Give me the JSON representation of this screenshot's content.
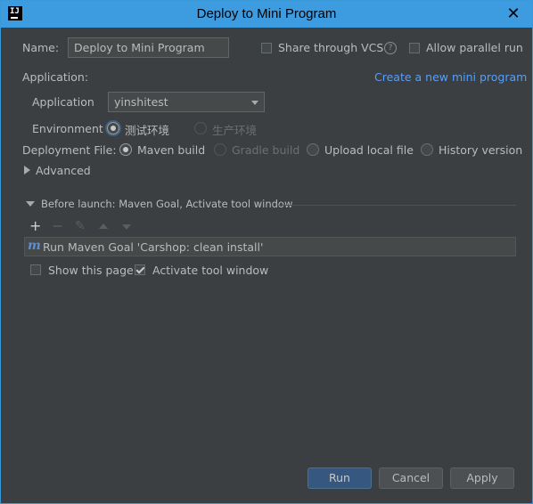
{
  "window": {
    "title": "Deploy to Mini Program",
    "app_icon_text": "IJ",
    "close_glyph": "✕"
  },
  "name": {
    "label": "Name:",
    "value": "Deploy to Mini Program"
  },
  "share_vcs": {
    "label": "Share through VCS",
    "checked": false,
    "help_glyph": "?"
  },
  "allow_parallel": {
    "label": "Allow parallel run",
    "checked": false
  },
  "application_section": {
    "heading": "Application:",
    "create_link": "Create a new mini program",
    "application_label": "Application",
    "application_value": "yinshitest",
    "environment_label": "Environment",
    "environment_options": [
      {
        "label": "测试环境",
        "selected": true
      },
      {
        "label": "生产环境",
        "selected": false,
        "disabled": true
      }
    ]
  },
  "deployment": {
    "label": "Deployment File:",
    "options": [
      {
        "label": "Maven build",
        "selected": true
      },
      {
        "label": "Gradle build",
        "selected": false,
        "disabled": true
      },
      {
        "label": "Upload local file",
        "selected": false
      },
      {
        "label": "History version",
        "selected": false
      }
    ]
  },
  "advanced": {
    "label": "Advanced"
  },
  "before_launch": {
    "heading": "Before launch: Maven Goal, Activate tool window",
    "toolbar": {
      "add_glyph": "+",
      "remove_glyph": "−",
      "edit_glyph": "✎"
    },
    "tasks": [
      {
        "icon_text": "m",
        "label": "Run Maven Goal 'Carshop: clean install'"
      }
    ],
    "show_page": {
      "label": "Show this page",
      "checked": false
    },
    "activate_tool_window": {
      "label": "Activate tool window",
      "checked": true
    }
  },
  "buttons": {
    "run": "Run",
    "cancel": "Cancel",
    "apply": "Apply"
  },
  "colors": {
    "title_bar": "#3d9be0",
    "background": "#3c3f41",
    "link": "#589df6",
    "primary_button": "#365880"
  }
}
